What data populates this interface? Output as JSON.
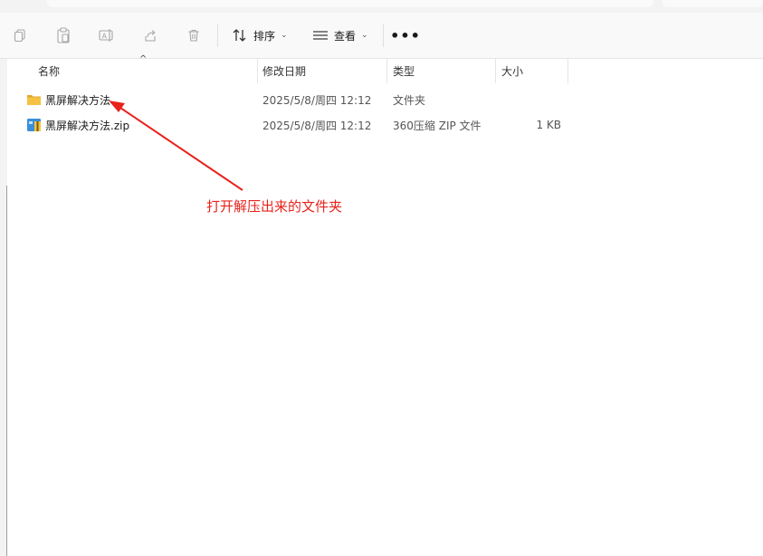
{
  "toolbar": {
    "icons": [
      "copy-icon",
      "paste-icon",
      "rename-icon",
      "share-icon",
      "delete-icon"
    ],
    "sort_label": "排序",
    "view_label": "查看",
    "more_label": "•••"
  },
  "columns": {
    "name": "名称",
    "modified": "修改日期",
    "type": "类型",
    "size": "大小"
  },
  "files": [
    {
      "name": "黑屏解决方法",
      "modified": "2025/5/8/周四 12:12",
      "type": "文件夹",
      "size": "",
      "icon": "folder-icon"
    },
    {
      "name": "黑屏解决方法.zip",
      "modified": "2025/5/8/周四 12:12",
      "type": "360压缩 ZIP 文件",
      "size": "1 KB",
      "icon": "zip-archive-icon"
    }
  ],
  "annotation": {
    "text": "打开解压出来的文件夹",
    "color": "#e8231c"
  },
  "colors": {
    "toolbar_bg": "#f9f9f9",
    "folder_yellow": "#f5c242",
    "accent_blue": "#1f6fd1"
  }
}
